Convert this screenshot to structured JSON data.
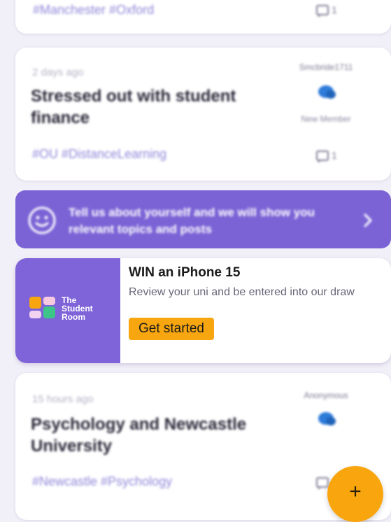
{
  "post_top": {
    "tags": "#Manchester #Oxford",
    "comment_count": "1"
  },
  "post_finance": {
    "time": "2 days ago",
    "title": "Stressed out with student finance",
    "author": "Smcbride1711",
    "author_badge": "New Member",
    "tags": "#OU #DistanceLearning",
    "comment_count": "1"
  },
  "personalize_banner": {
    "text": "Tell us about yourself and we will show you relevant topics and posts",
    "chevron": "chevron-right-icon"
  },
  "promo": {
    "brand": "The Student Room",
    "title": "WIN an iPhone 15",
    "description": "Review your uni and be entered into our draw",
    "cta": "Get started"
  },
  "post_psych": {
    "time": "15 hours ago",
    "title": "Psychology and Newcastle University",
    "author": "Anonymous",
    "tags": "#Newcastle #Psychology"
  },
  "fab": {
    "label": "+"
  },
  "colors": {
    "accent": "#7b63d6",
    "cta": "#f7a60f",
    "tag": "#8f86d9"
  }
}
